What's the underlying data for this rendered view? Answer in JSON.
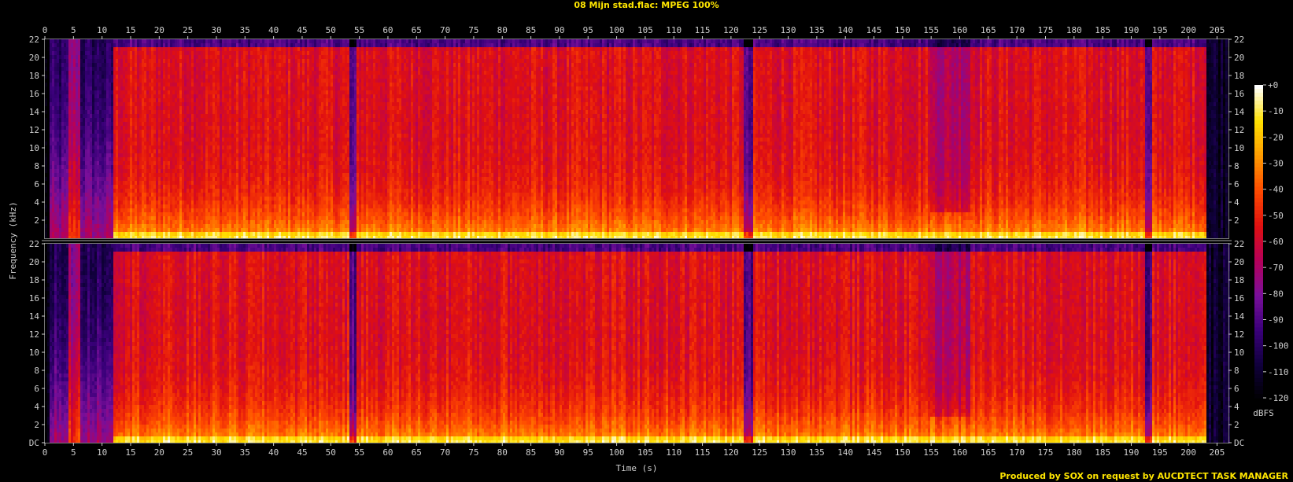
{
  "window": {
    "title": "08 Mijn stad.flac: MPEG 100%",
    "credit": "Produced by SOX on request by AUCDTECT TASK MANAGER"
  },
  "colors": {
    "background": "#000000",
    "text": "#cfcfcf",
    "title": "#ffe600",
    "palette": [
      "#000000",
      "#10003c",
      "#3a007a",
      "#7a0f9a",
      "#b5005a",
      "#e01010",
      "#ff4a00",
      "#ff9a00",
      "#ffe000",
      "#ffffff"
    ]
  },
  "chart_data": {
    "type": "heatmap",
    "title": "08 Mijn stad.flac: MPEG 100%",
    "xlabel": "Time (s)",
    "ylabel": "Frequency (kHz)",
    "xlim": [
      0,
      207
    ],
    "ylim": [
      0,
      22
    ],
    "x_ticks": [
      0,
      5,
      10,
      15,
      20,
      25,
      30,
      35,
      40,
      45,
      50,
      55,
      60,
      65,
      70,
      75,
      80,
      85,
      90,
      95,
      100,
      105,
      110,
      115,
      120,
      125,
      130,
      135,
      140,
      145,
      150,
      155,
      160,
      165,
      170,
      175,
      180,
      185,
      190,
      195,
      200,
      205
    ],
    "y_tick_labels": [
      "DC",
      "2",
      "4",
      "6",
      "8",
      "10",
      "12",
      "14",
      "16",
      "18",
      "20",
      "22"
    ],
    "channels": [
      "left",
      "right"
    ],
    "colorbar": {
      "label": "dBFS",
      "ticks": [
        "+0",
        "-10",
        "-20",
        "-30",
        "-40",
        "-50",
        "-60",
        "-70",
        "-80",
        "-90",
        "-100",
        "-110",
        "-120"
      ],
      "range": [
        -120,
        0
      ]
    },
    "approx_levels_dbfs": {
      "audio_start_s": 12,
      "audio_end_s": 203,
      "quiet_intro_0_12s": -100,
      "body_high_freq": -55,
      "body_low_freq": -25,
      "dips_s": [
        54,
        123,
        193
      ],
      "softer_section_s": [
        155,
        162
      ]
    }
  }
}
